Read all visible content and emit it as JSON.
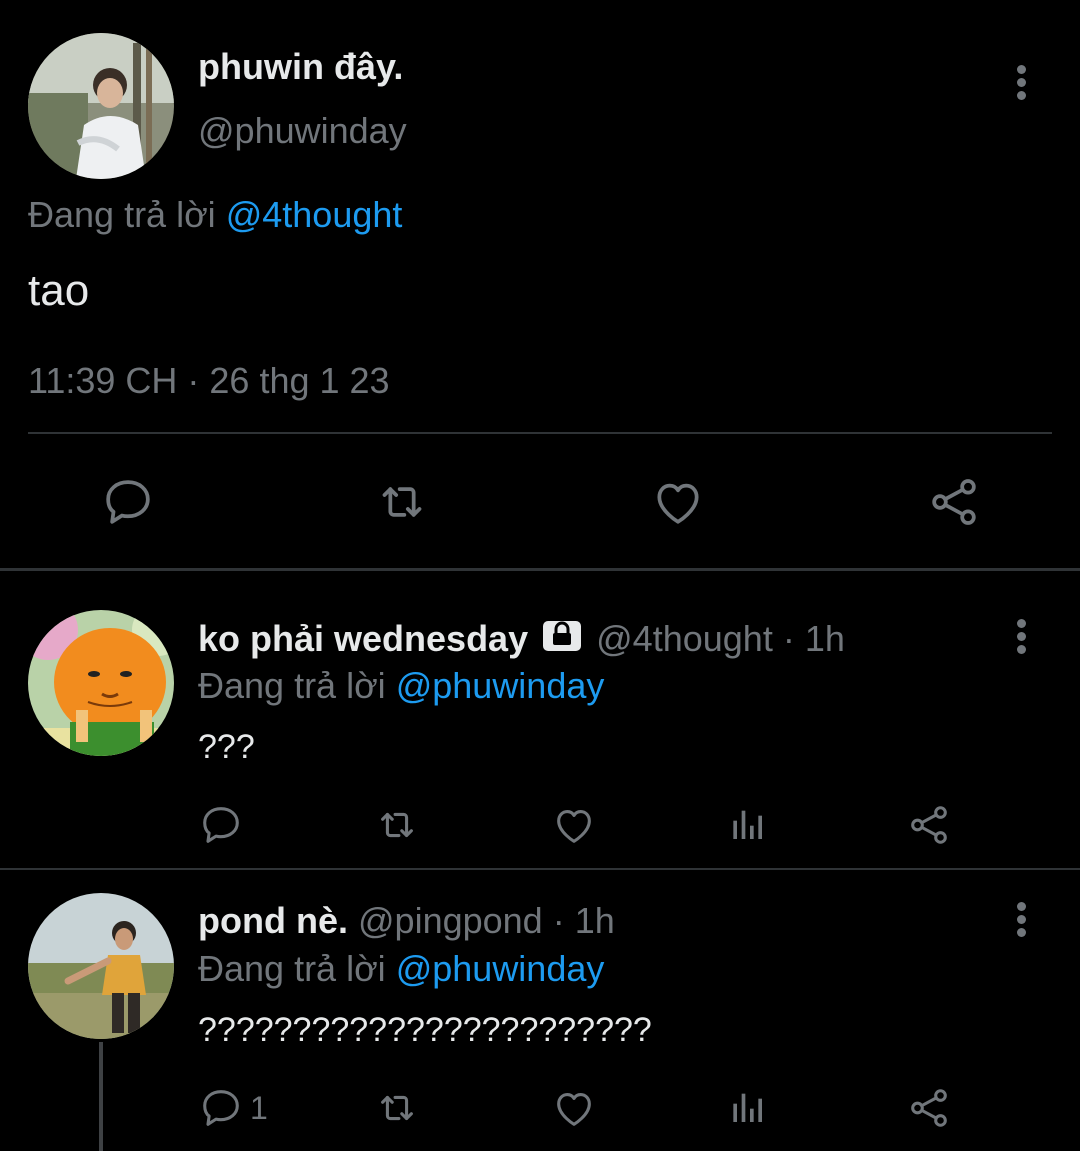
{
  "main_tweet": {
    "display_name": "phuwin đây.",
    "handle": "@phuwinday",
    "replying_prefix": "Đang trả lời",
    "replying_to": "@4thought",
    "text": "tao",
    "timestamp": "11:39 CH · 26 thg 1 23",
    "actions": [
      "reply-icon",
      "retweet-icon",
      "like-icon",
      "share-icon"
    ]
  },
  "replies": [
    {
      "display_name": "ko phải wednesday",
      "protected_icon": "lock-icon",
      "handle": "@4thought",
      "separator": "·",
      "time": "1h",
      "replying_prefix": "Đang trả lời",
      "replying_to": "@phuwinday",
      "text": "???",
      "reply_count": "",
      "actions": [
        "reply-icon",
        "retweet-icon",
        "like-icon",
        "analytics-icon",
        "share-icon"
      ]
    },
    {
      "display_name": "pond nè.",
      "handle": "@pingpond",
      "separator": "·",
      "time": "1h",
      "replying_prefix": "Đang trả lời",
      "replying_to": "@phuwinday",
      "text": "????????????????????????",
      "reply_count": "1",
      "actions": [
        "reply-icon",
        "retweet-icon",
        "like-icon",
        "analytics-icon",
        "share-icon"
      ]
    }
  ],
  "colors": {
    "background": "#000000",
    "text": "#e7e9ea",
    "muted": "#71767b",
    "link": "#1d9bf0",
    "divider": "#2f3336"
  }
}
